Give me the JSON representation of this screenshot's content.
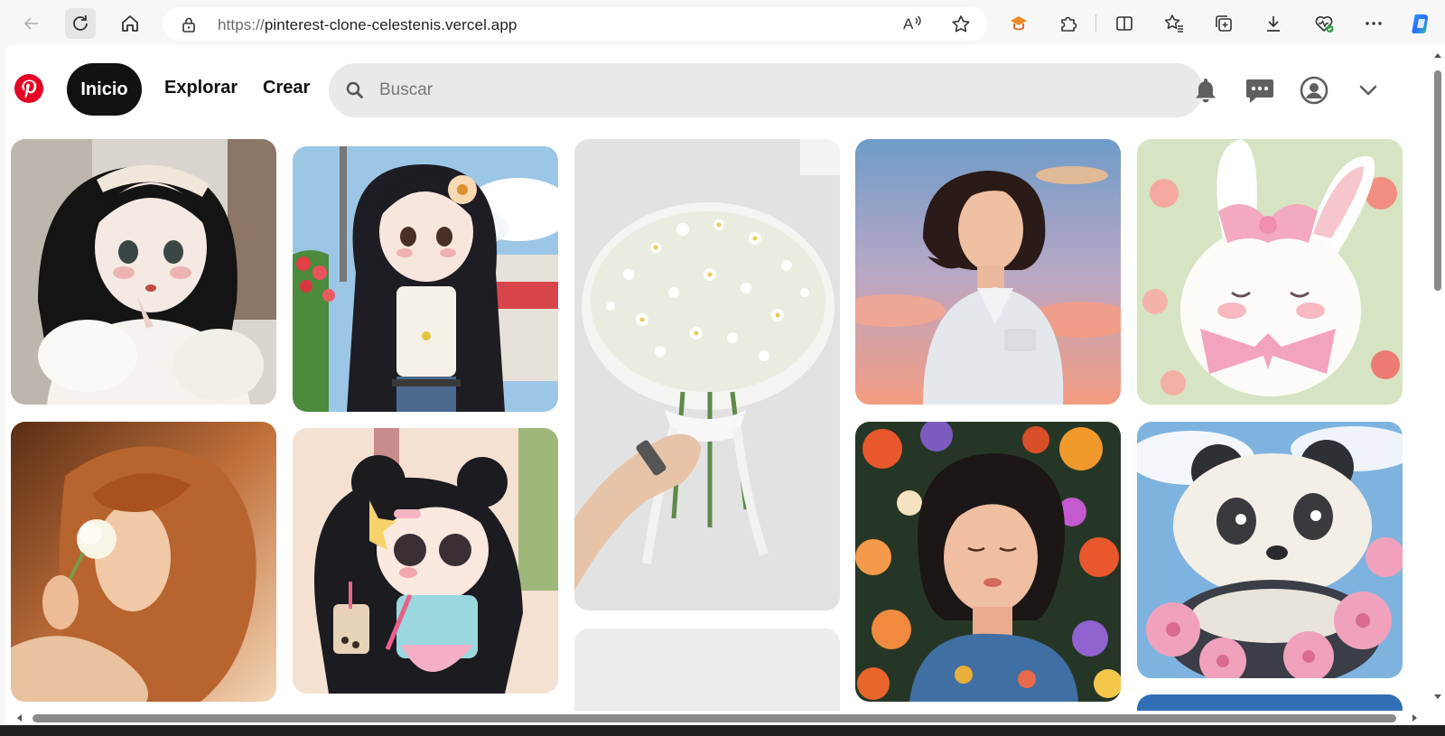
{
  "browser": {
    "url_scheme": "https://",
    "url_host": "pinterest-clone-celestenis.vercel.app",
    "icons": [
      "back-icon",
      "refresh-icon",
      "home-icon",
      "lock-icon",
      "read-aloud-icon",
      "favorite-star-icon",
      "extension-icon",
      "puzzle-icon",
      "split-screen-icon",
      "favorites-icon",
      "collections-icon",
      "download-icon",
      "browser-essentials-icon",
      "more-icon",
      "copilot-icon"
    ]
  },
  "header": {
    "home_label": "Inicio",
    "explore_label": "Explorar",
    "create_label": "Crear",
    "search_placeholder": "Buscar"
  },
  "colors": {
    "brand": "#e60023",
    "nav_active_bg": "#111111",
    "search_bg": "#e9e9e9"
  },
  "pins": [
    {
      "subject": "anime girl with headband",
      "col": 1
    },
    {
      "subject": "anime girl with flower hair clip",
      "col": 2
    },
    {
      "subject": "white flower bouquet",
      "col": 3
    },
    {
      "subject": "girl at sunset",
      "col": 4
    },
    {
      "subject": "white bunny with pink bow",
      "col": 5
    },
    {
      "subject": "girl smelling flower",
      "col": 1
    },
    {
      "subject": "chibi girl with bubble tea",
      "col": 2
    },
    {
      "subject": "blank pin",
      "col": 3
    },
    {
      "subject": "girl in flowers",
      "col": 4
    },
    {
      "subject": "panda with pink flowers",
      "col": 5
    }
  ]
}
